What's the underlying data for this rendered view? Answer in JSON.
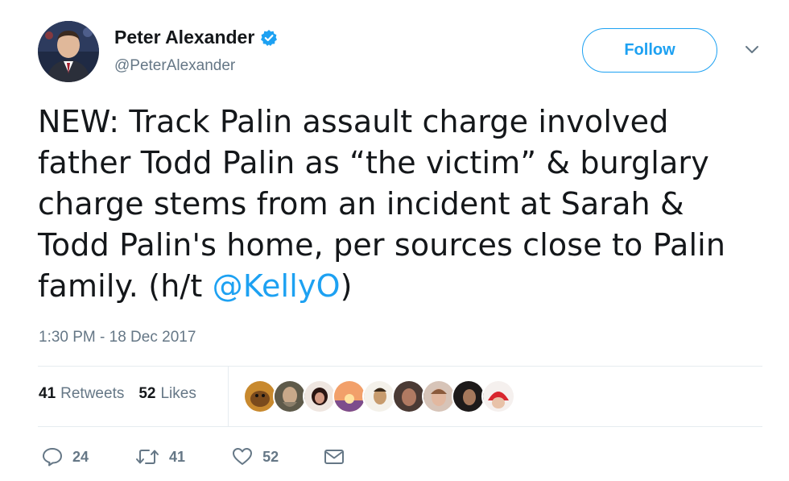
{
  "user": {
    "name": "Peter Alexander",
    "handle": "@PeterAlexander",
    "verified": true
  },
  "follow_button": {
    "label": "Follow"
  },
  "tweet": {
    "lines": [
      "NEW: Track Palin assault charge involved",
      "father Todd Palin as “the victim” & burglary",
      "charge stems from an incident at Sarah &",
      "Todd Palin's home, per sources close to Palin"
    ],
    "last_line_prefix": "family. (h/t ",
    "mention": "@KellyO",
    "last_line_suffix": ")",
    "timestamp": "1:30 PM - 18 Dec 2017"
  },
  "stats": {
    "retweets_count": "41",
    "retweets_label": "Retweets",
    "likes_count": "52",
    "likes_label": "Likes"
  },
  "actions": {
    "reply_count": "24",
    "retweet_count": "41",
    "like_count": "52"
  },
  "colors": {
    "accent": "#1da1f2",
    "text": "#14171a",
    "secondary": "#657786",
    "divider": "#e6ecf0"
  }
}
